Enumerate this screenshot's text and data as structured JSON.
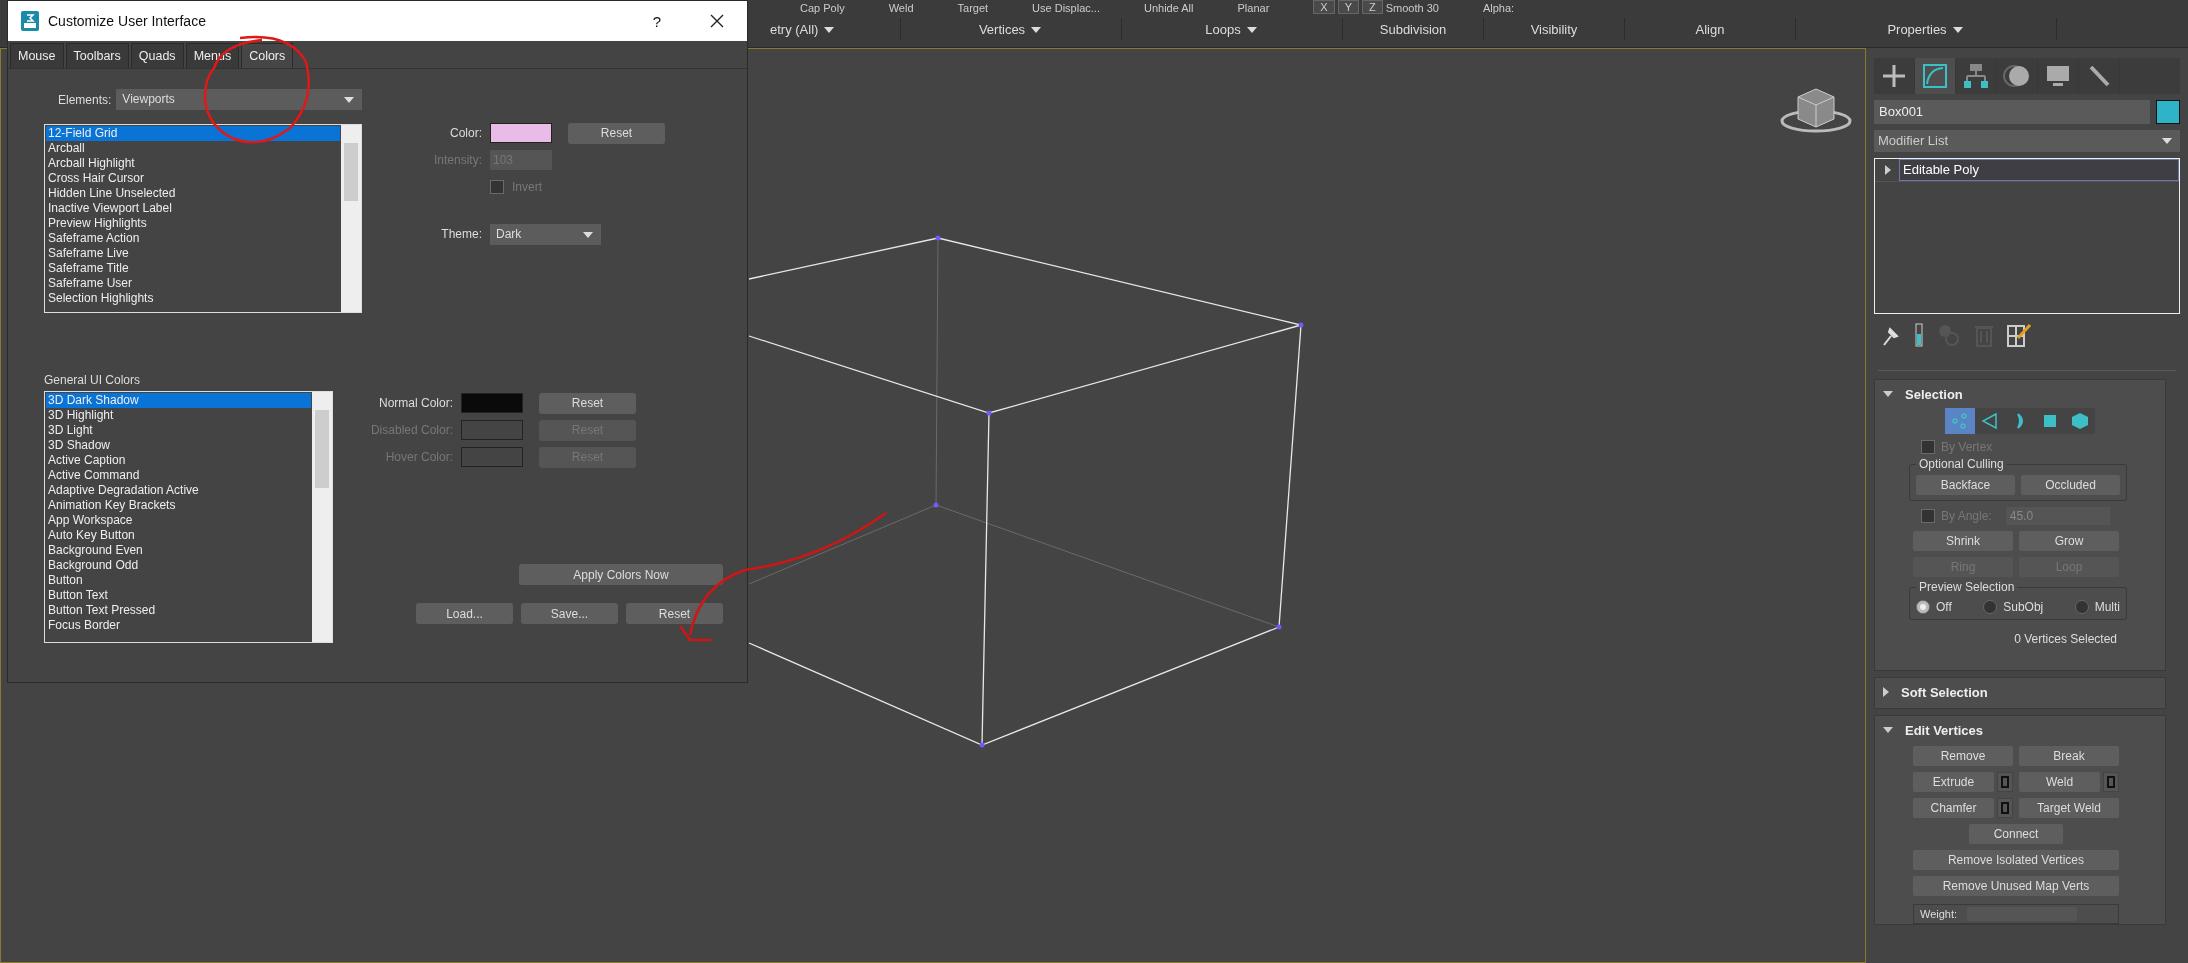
{
  "ribbon": {
    "top_items": [
      {
        "label": "Cap Poly",
        "kind": "text"
      },
      {
        "label": "Weld",
        "kind": "text"
      },
      {
        "label": "Target",
        "kind": "text"
      },
      {
        "label": "Use Displac...",
        "kind": "text"
      },
      {
        "label": "Unhide All",
        "kind": "text"
      },
      {
        "label": "Planar",
        "kind": "text"
      },
      {
        "label": "X",
        "kind": "key"
      },
      {
        "label": "Y",
        "kind": "key"
      },
      {
        "label": "Z",
        "kind": "key"
      },
      {
        "label": "Smooth 30",
        "kind": "text"
      },
      {
        "label": "Alpha:",
        "kind": "text"
      }
    ],
    "groups": [
      {
        "label": "etry (All)",
        "dropdown": true
      },
      {
        "label": "Vertices",
        "dropdown": true
      },
      {
        "label": "Loops",
        "dropdown": true
      },
      {
        "label": "Subdivision",
        "dropdown": false
      },
      {
        "label": "Visibility",
        "dropdown": false
      },
      {
        "label": "Align",
        "dropdown": false
      },
      {
        "label": "Properties",
        "dropdown": true
      }
    ]
  },
  "dialog": {
    "title": "Customize User Interface",
    "help": "?",
    "tabs": [
      {
        "label": "Mouse",
        "selected": false
      },
      {
        "label": "Toolbars",
        "selected": false
      },
      {
        "label": "Quads",
        "selected": false
      },
      {
        "label": "Menus",
        "selected": false
      },
      {
        "label": "Colors",
        "selected": true
      }
    ],
    "elements": {
      "label": "Elements:",
      "value": "Viewports"
    },
    "viewport_list": [
      {
        "label": "12-Field Grid",
        "selected": true
      },
      {
        "label": "Arcball",
        "selected": false
      },
      {
        "label": "Arcball Highlight",
        "selected": false
      },
      {
        "label": "Cross Hair Cursor",
        "selected": false
      },
      {
        "label": "Hidden Line Unselected",
        "selected": false
      },
      {
        "label": "Inactive Viewport Label",
        "selected": false
      },
      {
        "label": "Preview Highlights",
        "selected": false
      },
      {
        "label": "Safeframe Action",
        "selected": false
      },
      {
        "label": "Safeframe Live",
        "selected": false
      },
      {
        "label": "Safeframe Title",
        "selected": false
      },
      {
        "label": "Safeframe User",
        "selected": false
      },
      {
        "label": "Selection Highlights",
        "selected": false
      }
    ],
    "color": {
      "label": "Color:",
      "color": "#e8bce6",
      "reset": "Reset"
    },
    "intensity": {
      "label": "Intensity:",
      "value": "103",
      "disabled": true
    },
    "invert": {
      "label": "Invert",
      "checked": false,
      "disabled": true
    },
    "theme": {
      "label": "Theme:",
      "value": "Dark"
    },
    "general_label": "General UI Colors",
    "general_list": [
      {
        "label": "3D Dark Shadow",
        "selected": true
      },
      {
        "label": "3D Highlight",
        "selected": false
      },
      {
        "label": "3D Light",
        "selected": false
      },
      {
        "label": "3D Shadow",
        "selected": false
      },
      {
        "label": "Active Caption",
        "selected": false
      },
      {
        "label": "Active Command",
        "selected": false
      },
      {
        "label": "Adaptive Degradation Active",
        "selected": false
      },
      {
        "label": "Animation Key Brackets",
        "selected": false
      },
      {
        "label": "App Workspace",
        "selected": false
      },
      {
        "label": "Auto Key Button",
        "selected": false
      },
      {
        "label": "Background Even",
        "selected": false
      },
      {
        "label": "Background Odd",
        "selected": false
      },
      {
        "label": "Button",
        "selected": false
      },
      {
        "label": "Button Text",
        "selected": false
      },
      {
        "label": "Button Text Pressed",
        "selected": false
      },
      {
        "label": "Focus Border",
        "selected": false
      }
    ],
    "ui_colors": [
      {
        "label": "Normal Color:",
        "color": "#0a0a0a",
        "disabled": false,
        "reset": "Reset"
      },
      {
        "label": "Disabled Color:",
        "color": "#444444",
        "disabled": true,
        "reset": "Reset"
      },
      {
        "label": "Hover Color:",
        "color": "#444444",
        "disabled": true,
        "reset": "Reset"
      }
    ],
    "apply": "Apply Colors Now",
    "bottom_buttons": [
      "Load...",
      "Save...",
      "Reset"
    ]
  },
  "panel": {
    "command_tabs": [
      {
        "kind": "create",
        "selected": false
      },
      {
        "kind": "modify",
        "selected": true
      },
      {
        "kind": "hierarchy",
        "selected": false
      },
      {
        "kind": "motion",
        "selected": false
      },
      {
        "kind": "display",
        "selected": false
      },
      {
        "kind": "utilities",
        "selected": false
      }
    ],
    "object_name": "Box001",
    "modifier_list": "Modifier List",
    "stack": [
      {
        "label": "Editable Poly",
        "selected": true
      }
    ],
    "selection": {
      "title": "Selection",
      "expanded": true,
      "subobjects": [
        {
          "kind": "vertex",
          "selected": true
        },
        {
          "kind": "edge",
          "selected": false
        },
        {
          "kind": "border",
          "selected": false
        },
        {
          "kind": "polygon",
          "selected": false
        },
        {
          "kind": "element",
          "selected": false
        }
      ],
      "by_vertex": {
        "label": "By Vertex",
        "checked": false,
        "disabled": true
      },
      "culling": {
        "label": "Optional Culling",
        "buttons": [
          "Backface",
          "Occluded"
        ]
      },
      "by_angle": {
        "label": "By Angle:",
        "value": "45.0",
        "checked": false,
        "disabled": true
      },
      "shrink_grow": [
        "Shrink",
        "Grow"
      ],
      "ring_loop": [
        {
          "label": "Ring",
          "disabled": true
        },
        {
          "label": "Loop",
          "disabled": true
        }
      ],
      "preview": {
        "label": "Preview Selection",
        "options": [
          {
            "label": "Off",
            "selected": true
          },
          {
            "label": "SubObj",
            "selected": false
          },
          {
            "label": "Multi",
            "selected": false
          }
        ]
      },
      "status": "0 Vertices Selected"
    },
    "soft_selection": {
      "title": "Soft Selection",
      "expanded": false
    },
    "edit_vertices": {
      "title": "Edit Vertices",
      "expanded": true,
      "rows": [
        [
          {
            "label": "Remove",
            "settings": false
          },
          {
            "label": "Break",
            "settings": false
          }
        ],
        [
          {
            "label": "Extrude",
            "settings": true
          },
          {
            "label": "Weld",
            "settings": true
          }
        ],
        [
          {
            "label": "Chamfer",
            "settings": true
          },
          {
            "label": "Target Weld",
            "settings": false
          }
        ],
        [
          {
            "label": "Connect",
            "settings": false
          }
        ],
        [
          {
            "label": "Remove Isolated Vertices",
            "settings": false
          }
        ],
        [
          {
            "label": "Remove Unused Map Verts",
            "settings": false
          }
        ]
      ],
      "weight": "Weight:"
    }
  }
}
